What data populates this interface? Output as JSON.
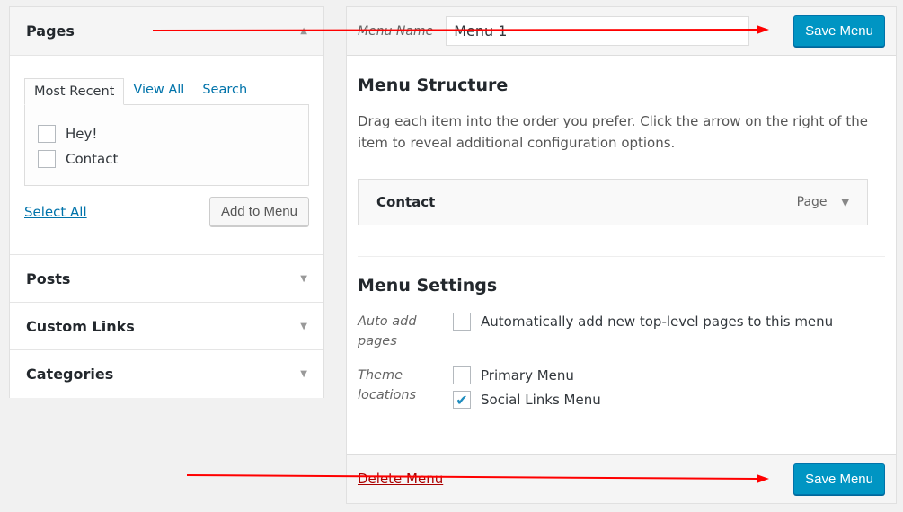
{
  "left": {
    "pages": {
      "title": "Pages",
      "tabs": [
        "Most Recent",
        "View All",
        "Search"
      ],
      "items": [
        {
          "label": "Hey!",
          "checked": false
        },
        {
          "label": "Contact",
          "checked": false
        }
      ],
      "select_all": "Select All",
      "add_button": "Add to Menu"
    },
    "sections": [
      "Posts",
      "Custom Links",
      "Categories"
    ]
  },
  "right": {
    "menu_name_label": "Menu Name",
    "menu_name_value": "Menu 1",
    "save_label": "Save Menu",
    "structure": {
      "title": "Menu Structure",
      "description": "Drag each item into the order you prefer. Click the arrow on the right of the item to reveal additional configuration options.",
      "items": [
        {
          "title": "Contact",
          "type": "Page"
        }
      ]
    },
    "settings": {
      "title": "Menu Settings",
      "auto_add_label": "Auto add pages",
      "auto_add_option": "Automatically add new top-level pages to this menu",
      "auto_add_checked": false,
      "theme_locations_label": "Theme locations",
      "locations": [
        {
          "label": "Primary Menu",
          "checked": false
        },
        {
          "label": "Social Links Menu",
          "checked": true
        }
      ]
    },
    "delete_label": "Delete Menu"
  },
  "colors": {
    "primary_button": "#0095c3",
    "link": "#0073aa",
    "annotation_arrow": "#ff0000"
  }
}
